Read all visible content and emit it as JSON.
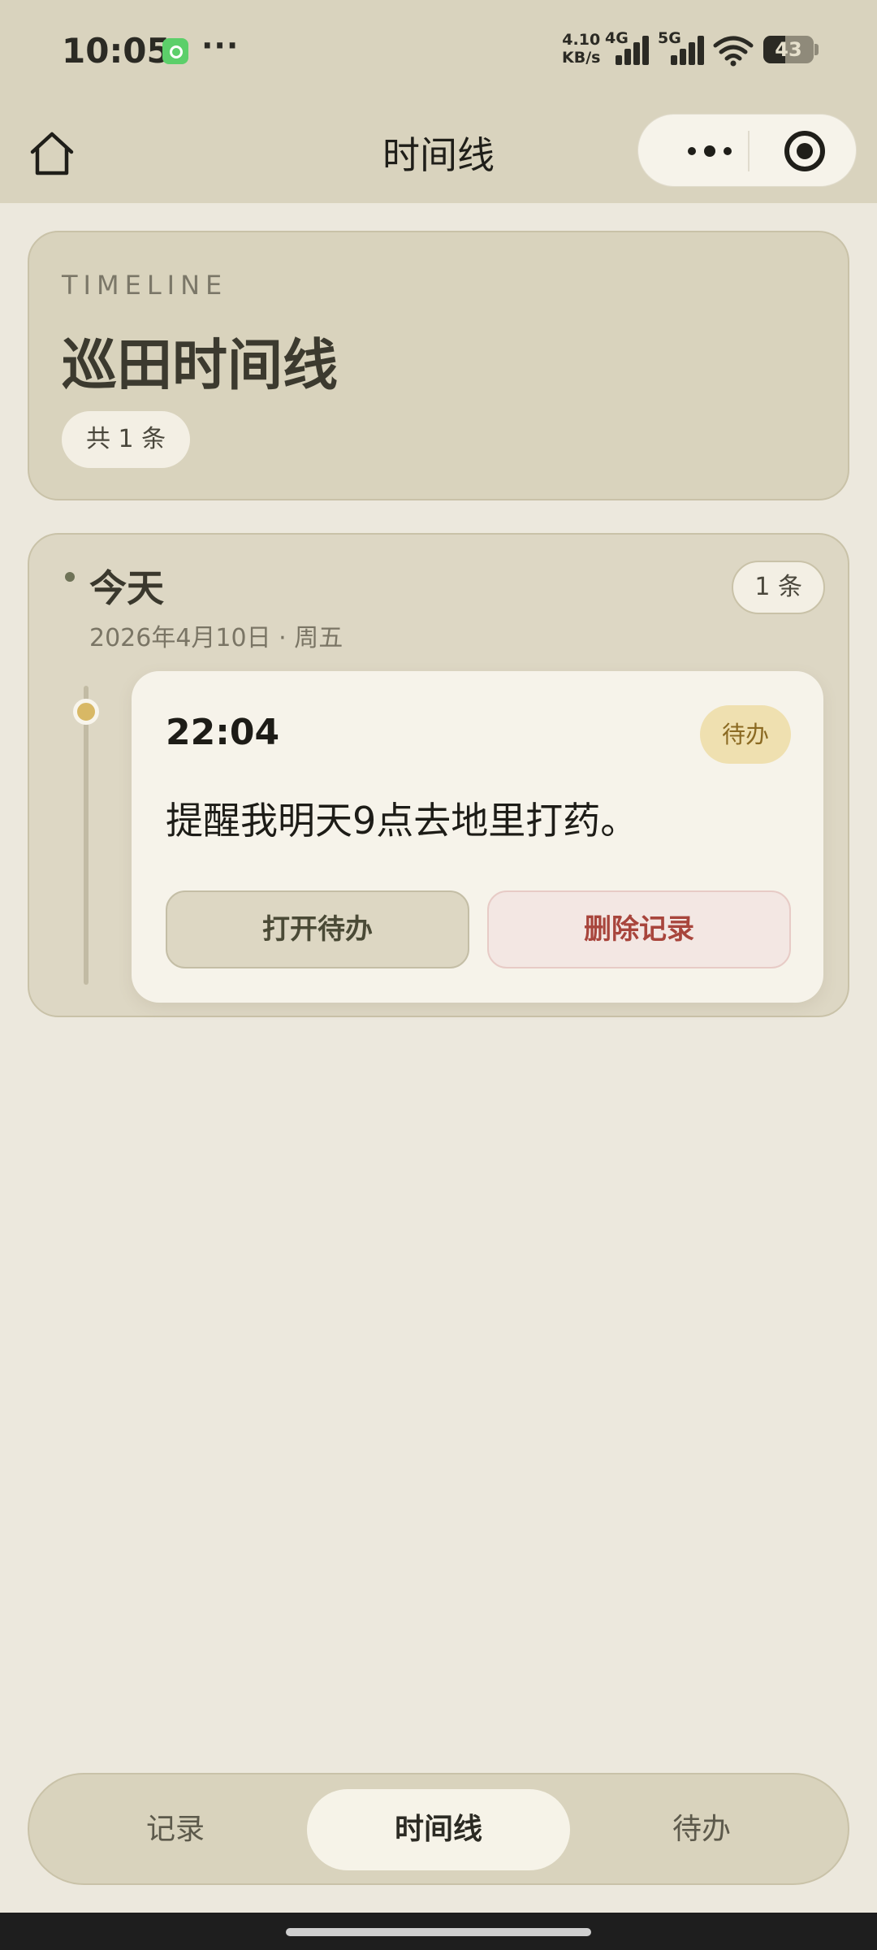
{
  "status_bar": {
    "time": "10:05",
    "more": "···",
    "speed_value": "4.10",
    "speed_unit": "KB/s",
    "net_4g": "4G",
    "net_5g": "5G",
    "battery": "43"
  },
  "nav": {
    "title": "时间线"
  },
  "header": {
    "eyebrow": "TIMELINE",
    "title": "巡田时间线",
    "count": "共 1 条"
  },
  "groups": [
    {
      "label": "今天",
      "date": "2026年4月10日 · 周五",
      "count": "1 条",
      "entries": [
        {
          "time": "22:04",
          "tag": "待办",
          "text": "提醒我明天9点去地里打药。",
          "open_label": "打开待办",
          "delete_label": "删除记录"
        }
      ]
    }
  ],
  "tabs": [
    {
      "label": "记录"
    },
    {
      "label": "时间线"
    },
    {
      "label": "待办"
    }
  ],
  "active_tab": "时间线",
  "colors": {
    "background": "#ece8dd",
    "bar": "#d9d3be",
    "tag_bg": "#efe0b0",
    "delete_text": "#a8453c",
    "timeline_node": "#d8b865"
  }
}
